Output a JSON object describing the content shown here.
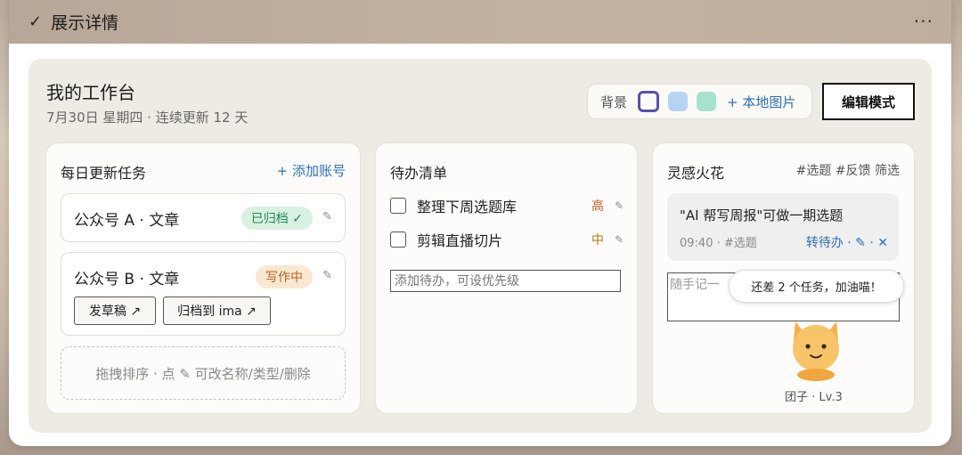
{
  "topbar": {
    "title": "展示详情",
    "more": "···"
  },
  "header": {
    "title": "我的工作台",
    "subtitle": "7月30日 星期四 · 连续更新 12 天",
    "bg_label": "背景",
    "local_image": "+ 本地图片",
    "edit_button": "编辑模式",
    "swatch_colors": [
      "#fbfaf7",
      "#b7d3f2",
      "#a6e3cd"
    ],
    "selected_swatch_border": "#5a4fb0"
  },
  "daily": {
    "title": "每日更新任务",
    "add": "+ 添加账号",
    "cards": [
      {
        "name": "公众号 A · 文章",
        "status": "已归档 ✓"
      },
      {
        "name": "公众号 B · 文章",
        "status": "写作中",
        "buttons": [
          "发草稿 ↗",
          "归档到 ima ↗"
        ]
      }
    ],
    "hint": "拖拽排序 · 点 ✎ 可改名称/类型/删除"
  },
  "todo": {
    "title": "待办清单",
    "items": [
      {
        "text": "整理下周选题库",
        "priority": "高"
      },
      {
        "text": "剪辑直播切片",
        "priority": "中"
      }
    ],
    "input_placeholder": "添加待办，可设优先级"
  },
  "ideas": {
    "title": "灵感火花",
    "tags": "#选题 #反馈 筛选",
    "card": {
      "text": "\"AI 帮写周报\"可做一期选题",
      "meta": "09:40 · #选题",
      "actions": "转待办 · ✎ · ✕"
    },
    "note_placeholder": "随手记一",
    "bubble": "还差 2 个任务，加油喵！",
    "pet_name": "团子 · Lv.3"
  }
}
